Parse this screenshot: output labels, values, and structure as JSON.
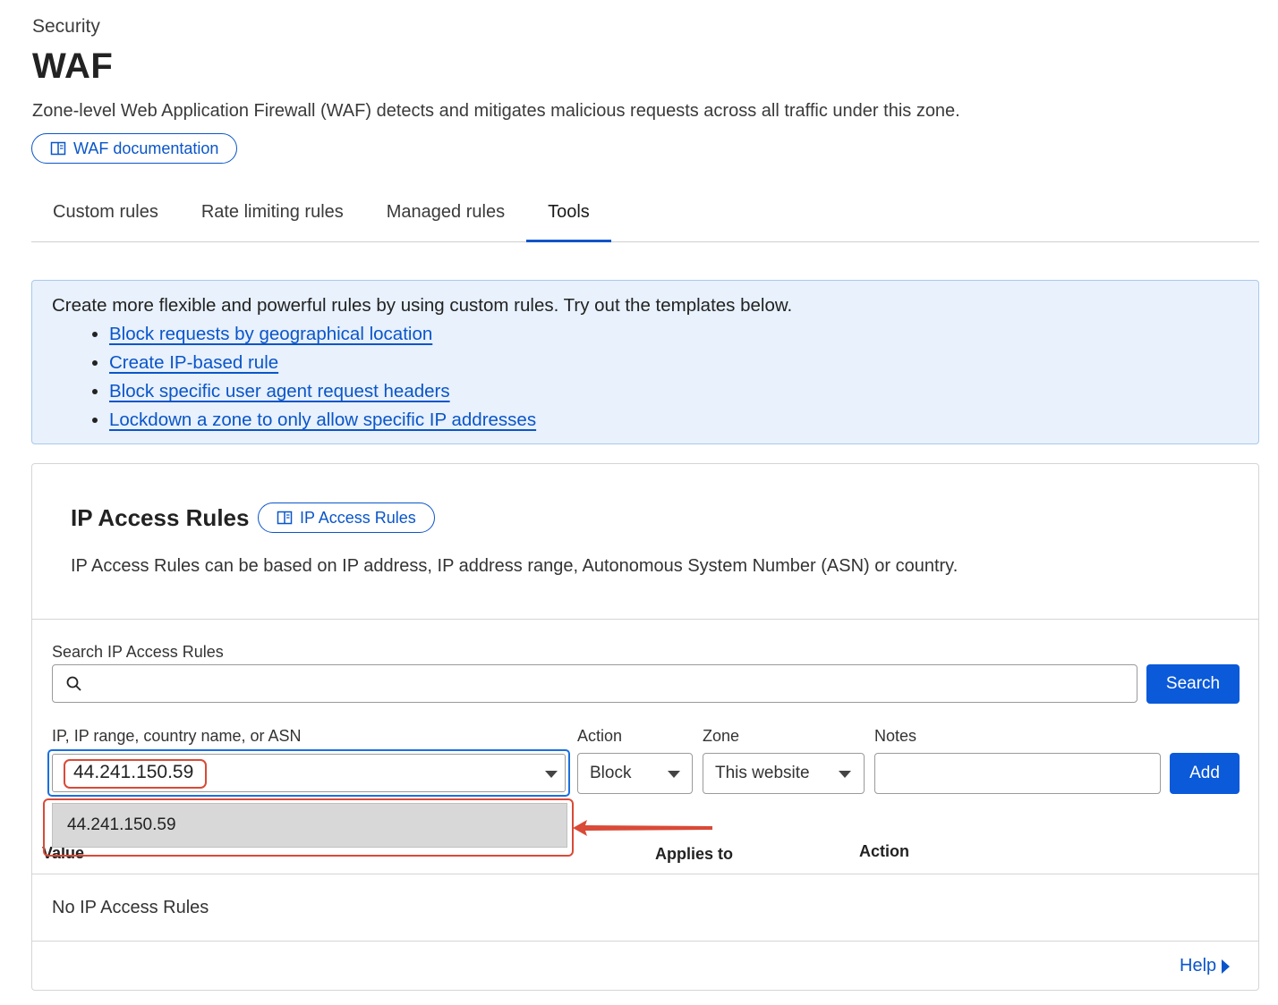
{
  "header": {
    "breadcrumb": "Security",
    "title": "WAF",
    "description": "Zone-level Web Application Firewall (WAF) detects and mitigates malicious requests across all traffic under this zone.",
    "doc_link": "WAF documentation"
  },
  "tabs": [
    {
      "label": "Custom rules",
      "active": false
    },
    {
      "label": "Rate limiting rules",
      "active": false
    },
    {
      "label": "Managed rules",
      "active": false
    },
    {
      "label": "Tools",
      "active": true
    }
  ],
  "info_box": {
    "intro": "Create more flexible and powerful rules by using custom rules. Try out the templates below.",
    "links": [
      "Block requests by geographical location",
      "Create IP-based rule",
      "Block specific user agent request headers",
      "Lockdown a zone to only allow specific IP addresses"
    ]
  },
  "ip_access": {
    "title": "IP Access Rules",
    "doc_link": "IP Access Rules",
    "description": "IP Access Rules can be based on IP address, IP address range, Autonomous System Number (ASN) or country.",
    "search": {
      "label": "Search IP Access Rules",
      "value": "",
      "button": "Search"
    },
    "form": {
      "ip_label": "IP, IP range, country name, or ASN",
      "ip_value": "44.241.150.59",
      "action_label": "Action",
      "action_value": "Block",
      "zone_label": "Zone",
      "zone_value": "This website",
      "notes_label": "Notes",
      "notes_value": "",
      "add_button": "Add"
    },
    "dropdown_option": "44.241.150.59",
    "table": {
      "columns": [
        "Value",
        "Applies to",
        "Action"
      ],
      "empty_text": "No IP Access Rules"
    },
    "help_link": "Help"
  },
  "colors": {
    "accent": "#0a55c9",
    "primary_button": "#0a5ad9",
    "info_bg": "#e8f1fc",
    "annotation": "#d94a37"
  },
  "icons": [
    "book-icon",
    "search-icon",
    "chevron-down-icon",
    "triangle-right-icon"
  ]
}
